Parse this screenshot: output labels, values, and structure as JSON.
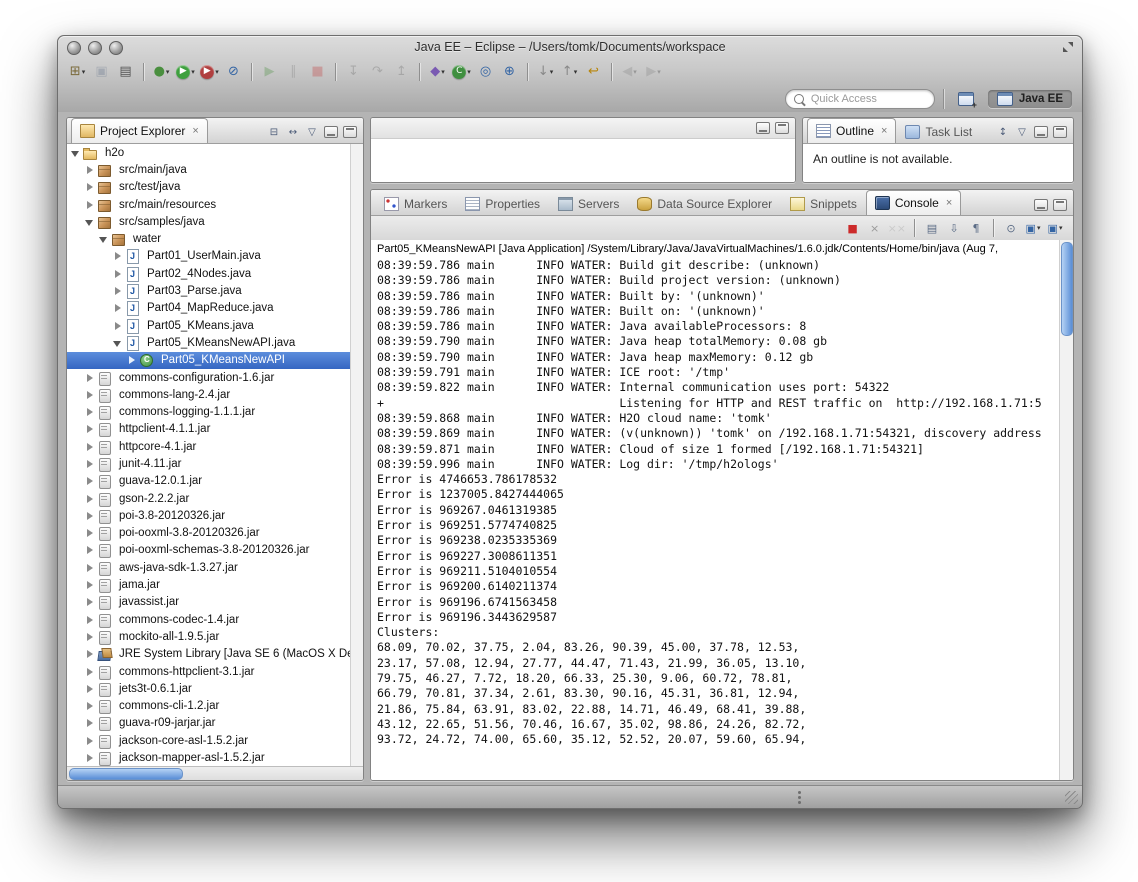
{
  "window": {
    "title": "Java EE – Eclipse – /Users/tomk/Documents/workspace"
  },
  "colors": {
    "selection_blue": "#3566c2",
    "scrollbar_blue": "#5a8ed6",
    "terminate_red": "#cc2a2a"
  },
  "toolbar": {
    "icons": [
      {
        "name": "new-wizard-button",
        "glyph": "⊞",
        "color": "#7a6a3a",
        "dropdown": true
      },
      {
        "name": "save-button",
        "glyph": "▣",
        "color": "#5a6b85",
        "disabled": true
      },
      {
        "name": "print-button",
        "glyph": "▤",
        "color": "#555555"
      },
      {
        "sep": true
      },
      {
        "name": "debug-button",
        "glyph": "●",
        "color": "#4a8f3f",
        "dropdown": true
      },
      {
        "name": "run-button",
        "glyph": "▶",
        "bg": "#3fa03f",
        "dropdown": true
      },
      {
        "name": "external-tools-button",
        "glyph": "▶",
        "bg": "#b04040",
        "dropdown": true
      },
      {
        "name": "skip-breakpoints-button",
        "glyph": "⊘",
        "color": "#3465a4"
      },
      {
        "sep": true
      },
      {
        "name": "resume-button",
        "glyph": "▶",
        "color": "#4a8f3f",
        "disabled": true
      },
      {
        "name": "suspend-button",
        "glyph": "∥",
        "color": "#777777",
        "disabled": true
      },
      {
        "name": "terminate-button",
        "glyph": "■",
        "color": "#c24040",
        "disabled": true
      },
      {
        "sep": true
      },
      {
        "name": "step-into-button",
        "glyph": "↧",
        "color": "#666666",
        "disabled": true
      },
      {
        "name": "step-over-button",
        "glyph": "↷",
        "color": "#666666",
        "disabled": true
      },
      {
        "name": "step-return-button",
        "glyph": "↥",
        "color": "#666666",
        "disabled": true
      },
      {
        "sep": true
      },
      {
        "name": "new-java-ee-project-button",
        "glyph": "◆",
        "color": "#7a5ab2",
        "dropdown": true
      },
      {
        "name": "new-java-class-button",
        "glyph": "C",
        "bg": "#3f8f3f",
        "dropdown": true
      },
      {
        "name": "java-search-button",
        "glyph": "◎",
        "color": "#3465a4"
      },
      {
        "name": "open-web-browser-button",
        "glyph": "⊕",
        "color": "#3465a4"
      },
      {
        "sep": true
      },
      {
        "name": "next-annotation-button",
        "glyph": "↓",
        "color": "#888888",
        "dropdown": true
      },
      {
        "name": "previous-annotation-button",
        "glyph": "↑",
        "color": "#888888",
        "dropdown": true
      },
      {
        "name": "last-edit-location-button",
        "glyph": "↩",
        "color": "#b8860b"
      },
      {
        "sep": true
      },
      {
        "name": "back-button",
        "glyph": "◀",
        "color": "#888888",
        "dropdown": true,
        "disabled": true
      },
      {
        "name": "forward-button",
        "glyph": "▶",
        "color": "#888888",
        "dropdown": true,
        "disabled": true
      }
    ]
  },
  "quick_access": {
    "placeholder": "Quick Access"
  },
  "perspective_bar": {
    "active_label": "Java EE"
  },
  "project_explorer": {
    "tabs": [
      {
        "name": "tab-project-explorer",
        "label": "Project Explorer",
        "icon": "explorer",
        "active": true
      }
    ],
    "tree": [
      {
        "label": "h2o",
        "depth": 0,
        "icon": "project",
        "arrow": "expanded"
      },
      {
        "label": "src/main/java",
        "depth": 1,
        "icon": "package",
        "arrow": "collapsed"
      },
      {
        "label": "src/test/java",
        "depth": 1,
        "icon": "package",
        "arrow": "collapsed"
      },
      {
        "label": "src/main/resources",
        "depth": 1,
        "icon": "package",
        "arrow": "collapsed"
      },
      {
        "label": "src/samples/java",
        "depth": 1,
        "icon": "package",
        "arrow": "expanded"
      },
      {
        "label": "water",
        "depth": 2,
        "icon": "package",
        "arrow": "expanded"
      },
      {
        "label": "Part01_UserMain.java",
        "depth": 3,
        "icon": "javafile",
        "arrow": "collapsed"
      },
      {
        "label": "Part02_4Nodes.java",
        "depth": 3,
        "icon": "javafile",
        "arrow": "collapsed"
      },
      {
        "label": "Part03_Parse.java",
        "depth": 3,
        "icon": "javafile",
        "arrow": "collapsed"
      },
      {
        "label": "Part04_MapReduce.java",
        "depth": 3,
        "icon": "javafile",
        "arrow": "collapsed"
      },
      {
        "label": "Part05_KMeans.java",
        "depth": 3,
        "icon": "javafile",
        "arrow": "collapsed"
      },
      {
        "label": "Part05_KMeansNewAPI.java",
        "depth": 3,
        "icon": "javafile",
        "arrow": "expanded"
      },
      {
        "label": "Part05_KMeansNewAPI",
        "depth": 4,
        "icon": "class",
        "arrow": "collapsed",
        "selected": true
      },
      {
        "label": "commons-configuration-1.6.jar",
        "depth": 1,
        "icon": "jar",
        "arrow": "collapsed"
      },
      {
        "label": "commons-lang-2.4.jar",
        "depth": 1,
        "icon": "jar",
        "arrow": "collapsed"
      },
      {
        "label": "commons-logging-1.1.1.jar",
        "depth": 1,
        "icon": "jar",
        "arrow": "collapsed"
      },
      {
        "label": "httpclient-4.1.1.jar",
        "depth": 1,
        "icon": "jar",
        "arrow": "collapsed"
      },
      {
        "label": "httpcore-4.1.jar",
        "depth": 1,
        "icon": "jar",
        "arrow": "collapsed"
      },
      {
        "label": "junit-4.11.jar",
        "depth": 1,
        "icon": "jar",
        "arrow": "collapsed"
      },
      {
        "label": "guava-12.0.1.jar",
        "depth": 1,
        "icon": "jar",
        "arrow": "collapsed"
      },
      {
        "label": "gson-2.2.2.jar",
        "depth": 1,
        "icon": "jar",
        "arrow": "collapsed"
      },
      {
        "label": "poi-3.8-20120326.jar",
        "depth": 1,
        "icon": "jar",
        "arrow": "collapsed"
      },
      {
        "label": "poi-ooxml-3.8-20120326.jar",
        "depth": 1,
        "icon": "jar",
        "arrow": "collapsed"
      },
      {
        "label": "poi-ooxml-schemas-3.8-20120326.jar",
        "depth": 1,
        "icon": "jar",
        "arrow": "collapsed"
      },
      {
        "label": "aws-java-sdk-1.3.27.jar",
        "depth": 1,
        "icon": "jar",
        "arrow": "collapsed"
      },
      {
        "label": "jama.jar",
        "depth": 1,
        "icon": "jar",
        "arrow": "collapsed"
      },
      {
        "label": "javassist.jar",
        "depth": 1,
        "icon": "jar",
        "arrow": "collapsed"
      },
      {
        "label": "commons-codec-1.4.jar",
        "depth": 1,
        "icon": "jar",
        "arrow": "collapsed"
      },
      {
        "label": "mockito-all-1.9.5.jar",
        "depth": 1,
        "icon": "jar",
        "arrow": "collapsed"
      },
      {
        "label": "JRE System Library [Java SE 6 (MacOS X De",
        "depth": 1,
        "icon": "library",
        "arrow": "collapsed"
      },
      {
        "label": "commons-httpclient-3.1.jar",
        "depth": 1,
        "icon": "jar",
        "arrow": "collapsed"
      },
      {
        "label": "jets3t-0.6.1.jar",
        "depth": 1,
        "icon": "jar",
        "arrow": "collapsed"
      },
      {
        "label": "commons-cli-1.2.jar",
        "depth": 1,
        "icon": "jar",
        "arrow": "collapsed"
      },
      {
        "label": "guava-r09-jarjar.jar",
        "depth": 1,
        "icon": "jar",
        "arrow": "collapsed"
      },
      {
        "label": "jackson-core-asl-1.5.2.jar",
        "depth": 1,
        "icon": "jar",
        "arrow": "collapsed"
      },
      {
        "label": "jackson-mapper-asl-1.5.2.jar",
        "depth": 1,
        "icon": "jar",
        "arrow": "collapsed"
      }
    ]
  },
  "outline": {
    "tabs": [
      {
        "name": "tab-outline",
        "label": "Outline",
        "icon": "outline",
        "active": true
      },
      {
        "name": "tab-task-list",
        "label": "Task List",
        "icon": "tasklist"
      }
    ],
    "message": "An outline is not available."
  },
  "bottom_panel": {
    "tabs": [
      {
        "name": "tab-markers",
        "label": "Markers",
        "icon": "markers"
      },
      {
        "name": "tab-properties",
        "label": "Properties",
        "icon": "properties"
      },
      {
        "name": "tab-servers",
        "label": "Servers",
        "icon": "servers"
      },
      {
        "name": "tab-data-source-explorer",
        "label": "Data Source Explorer",
        "icon": "datasource"
      },
      {
        "name": "tab-snippets",
        "label": "Snippets",
        "icon": "snippets"
      },
      {
        "name": "tab-console",
        "label": "Console",
        "icon": "console",
        "active": true
      }
    ],
    "console_toolbar": [
      {
        "name": "terminate-button",
        "glyph": "■",
        "color": "#cc2a2a"
      },
      {
        "name": "remove-launch-button",
        "glyph": "×",
        "color": "#9a9a9a"
      },
      {
        "name": "remove-all-terminated-button",
        "glyph": "××",
        "color": "#9a9a9a",
        "disabled": true
      },
      {
        "sep": true
      },
      {
        "name": "clear-console-button",
        "glyph": "▤",
        "color": "#5a6b85"
      },
      {
        "name": "scroll-lock-button",
        "glyph": "⇩",
        "color": "#5a6b85"
      },
      {
        "name": "word-wrap-button",
        "glyph": "¶",
        "color": "#5a6b85"
      },
      {
        "sep": true
      },
      {
        "name": "pin-console-button",
        "glyph": "⊙",
        "color": "#5a6b85"
      },
      {
        "name": "display-selected-console-button",
        "glyph": "▣",
        "color": "#3465a4",
        "dropdown": true
      },
      {
        "name": "open-console-button",
        "glyph": "▣",
        "color": "#3465a4",
        "dropdown": true
      }
    ],
    "console": {
      "header": "Part05_KMeansNewAPI [Java Application] /System/Library/Java/JavaVirtualMachines/1.6.0.jdk/Contents/Home/bin/java (Aug 7,",
      "lines": [
        "08:39:59.786 main      INFO WATER: Build git describe: (unknown)",
        "08:39:59.786 main      INFO WATER: Build project version: (unknown)",
        "08:39:59.786 main      INFO WATER: Built by: '(unknown)'",
        "08:39:59.786 main      INFO WATER: Built on: '(unknown)'",
        "08:39:59.786 main      INFO WATER: Java availableProcessors: 8",
        "08:39:59.790 main      INFO WATER: Java heap totalMemory: 0.08 gb",
        "08:39:59.790 main      INFO WATER: Java heap maxMemory: 0.12 gb",
        "08:39:59.791 main      INFO WATER: ICE root: '/tmp'",
        "08:39:59.822 main      INFO WATER: Internal communication uses port: 54322",
        "+                                  Listening for HTTP and REST traffic on  http://192.168.1.71:5",
        "08:39:59.868 main      INFO WATER: H2O cloud name: 'tomk'",
        "08:39:59.869 main      INFO WATER: (v(unknown)) 'tomk' on /192.168.1.71:54321, discovery address",
        "08:39:59.871 main      INFO WATER: Cloud of size 1 formed [/192.168.1.71:54321]",
        "08:39:59.996 main      INFO WATER: Log dir: '/tmp/h2ologs'",
        "Error is 4746653.786178532",
        "Error is 1237005.8427444065",
        "Error is 969267.0461319385",
        "Error is 969251.5774740825",
        "Error is 969238.0235335369",
        "Error is 969227.3008611351",
        "Error is 969211.5104010554",
        "Error is 969200.6140211374",
        "Error is 969196.6741563458",
        "Error is 969196.3443629587",
        "Clusters:",
        "68.09, 70.02, 37.75, 2.04, 83.26, 90.39, 45.00, 37.78, 12.53,",
        "23.17, 57.08, 12.94, 27.77, 44.47, 71.43, 21.99, 36.05, 13.10,",
        "79.75, 46.27, 7.72, 18.20, 66.33, 25.30, 9.06, 60.72, 78.81,",
        "66.79, 70.81, 37.34, 2.61, 83.30, 90.16, 45.31, 36.81, 12.94,",
        "21.86, 75.84, 63.91, 83.02, 22.88, 14.71, 46.49, 68.41, 39.88,",
        "43.12, 22.65, 51.56, 70.46, 16.67, 35.02, 98.86, 24.26, 82.72,",
        "93.72, 24.72, 74.00, 65.60, 35.12, 52.52, 20.07, 59.60, 65.94,"
      ]
    }
  }
}
